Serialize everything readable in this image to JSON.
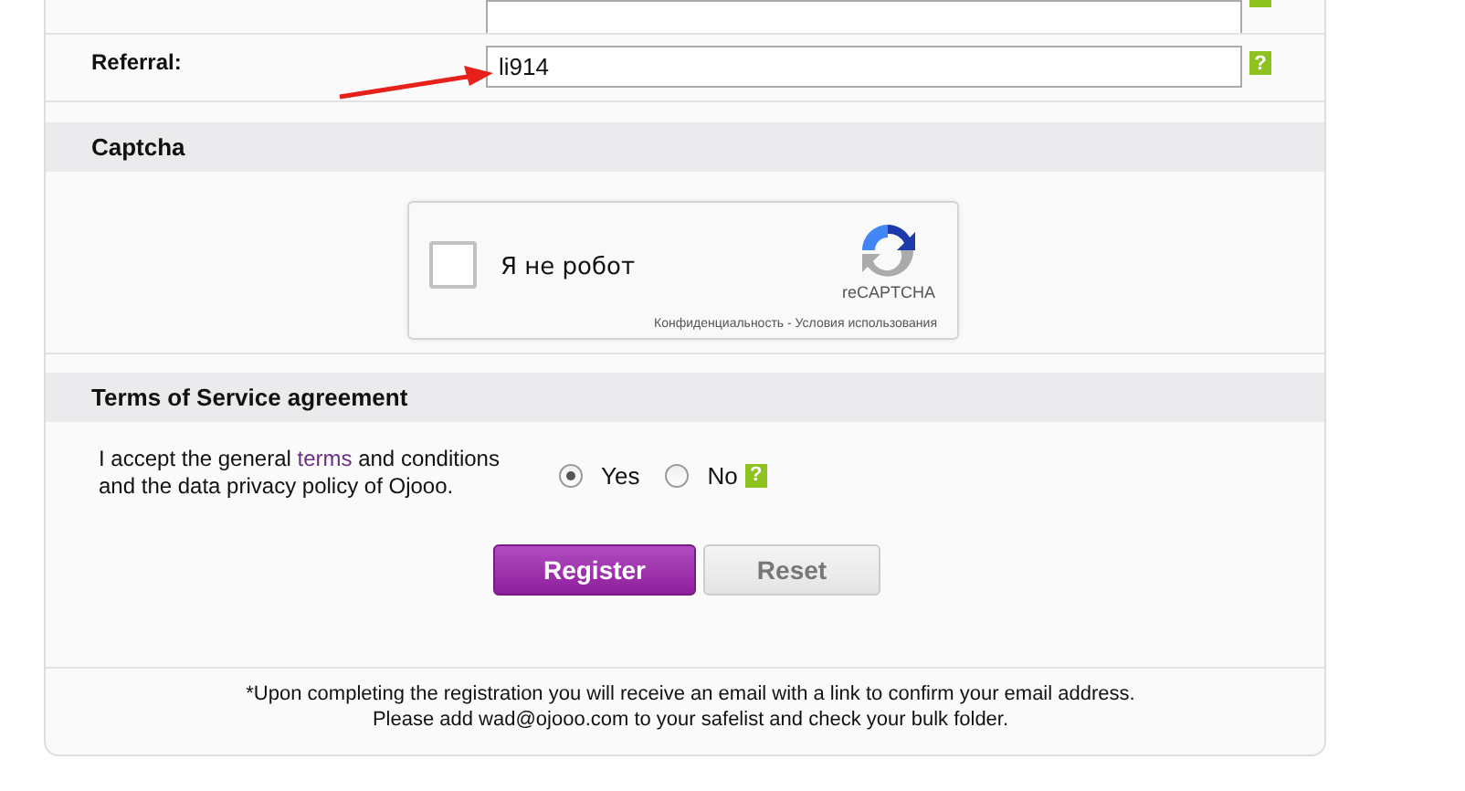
{
  "referral": {
    "label": "Referral:",
    "value": "li914"
  },
  "captcha": {
    "title": "Captcha",
    "checked": false,
    "label": "Я не робот",
    "brand": "reCAPTCHA",
    "privacy": "Конфиденциальность",
    "separator": " - ",
    "terms": "Условия использования"
  },
  "terms_section": {
    "title": "Terms of Service agreement",
    "text_before": "I accept the general ",
    "link": "terms",
    "text_after": " and conditions and the data privacy policy of Ojooo.",
    "options": [
      {
        "label": "Yes",
        "selected": true
      },
      {
        "label": "No",
        "selected": false
      }
    ],
    "help": "?"
  },
  "buttons": [
    {
      "label": "Register",
      "kind": "primary"
    },
    {
      "label": "Reset",
      "kind": "secondary"
    }
  ],
  "footer": [
    "*Upon completing the registration you will receive an email with a link to confirm your email address.",
    "Please add wad@ojooo.com to your safelist and check your bulk folder."
  ],
  "help_icons": [
    "?"
  ]
}
